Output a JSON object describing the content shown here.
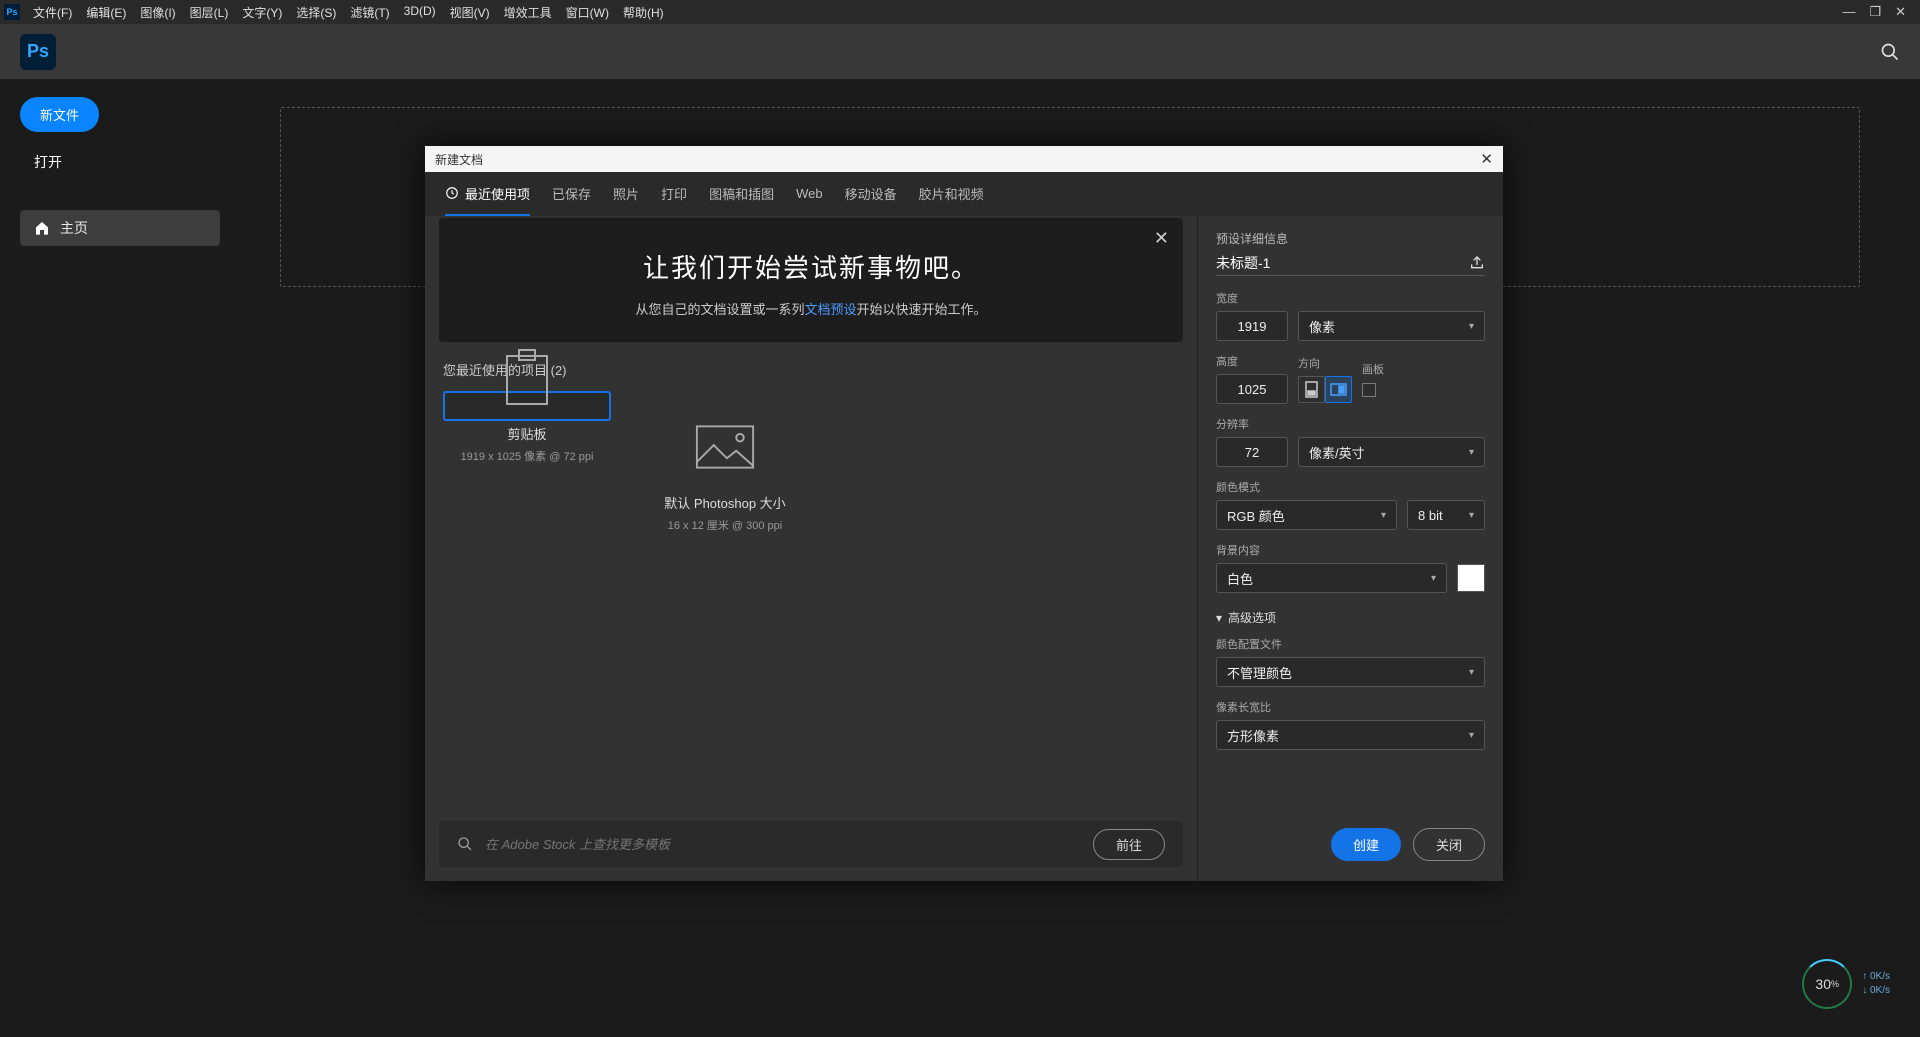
{
  "menubar": {
    "items": [
      "文件(F)",
      "编辑(E)",
      "图像(I)",
      "图层(L)",
      "文字(Y)",
      "选择(S)",
      "滤镜(T)",
      "3D(D)",
      "视图(V)",
      "增效工具",
      "窗口(W)",
      "帮助(H)"
    ]
  },
  "sidebar": {
    "new_file": "新文件",
    "open": "打开",
    "home": "主页"
  },
  "dialog": {
    "title": "新建文档",
    "tabs": [
      "最近使用项",
      "已保存",
      "照片",
      "打印",
      "图稿和插图",
      "Web",
      "移动设备",
      "胶片和视频"
    ],
    "banner": {
      "heading": "让我们开始尝试新事物吧。",
      "text_pre": "从您自己的文档设置或一系列",
      "text_link": "文档预设",
      "text_post": "开始以快速开始工作。"
    },
    "recent_label": "您最近使用的项目 (2)",
    "presets": [
      {
        "name": "剪贴板",
        "dim": "1919 x 1025 像素 @ 72 ppi",
        "selected": true,
        "icon": "clipboard"
      },
      {
        "name": "默认 Photoshop 大小",
        "dim": "16 x 12 厘米 @ 300 ppi",
        "selected": false,
        "icon": "image"
      }
    ],
    "stock": {
      "placeholder": "在 Adobe Stock 上查找更多模板",
      "go": "前往"
    }
  },
  "details": {
    "header": "预设详细信息",
    "doc_name": "未标题-1",
    "width_lbl": "宽度",
    "width_val": "1919",
    "width_unit": "像素",
    "height_lbl": "高度",
    "height_val": "1025",
    "orient_lbl": "方向",
    "artboard_lbl": "画板",
    "res_lbl": "分辨率",
    "res_val": "72",
    "res_unit": "像素/英寸",
    "color_lbl": "颜色模式",
    "color_mode": "RGB 颜色",
    "bit": "8 bit",
    "bg_lbl": "背景内容",
    "bg_val": "白色",
    "adv": "高级选项",
    "profile_lbl": "颜色配置文件",
    "profile_val": "不管理颜色",
    "aspect_lbl": "像素长宽比",
    "aspect_val": "方形像素",
    "create": "创建",
    "close": "关闭"
  },
  "net": {
    "pct": "30",
    "unit": "%",
    "up": "0K/s",
    "down": "0K/s"
  }
}
